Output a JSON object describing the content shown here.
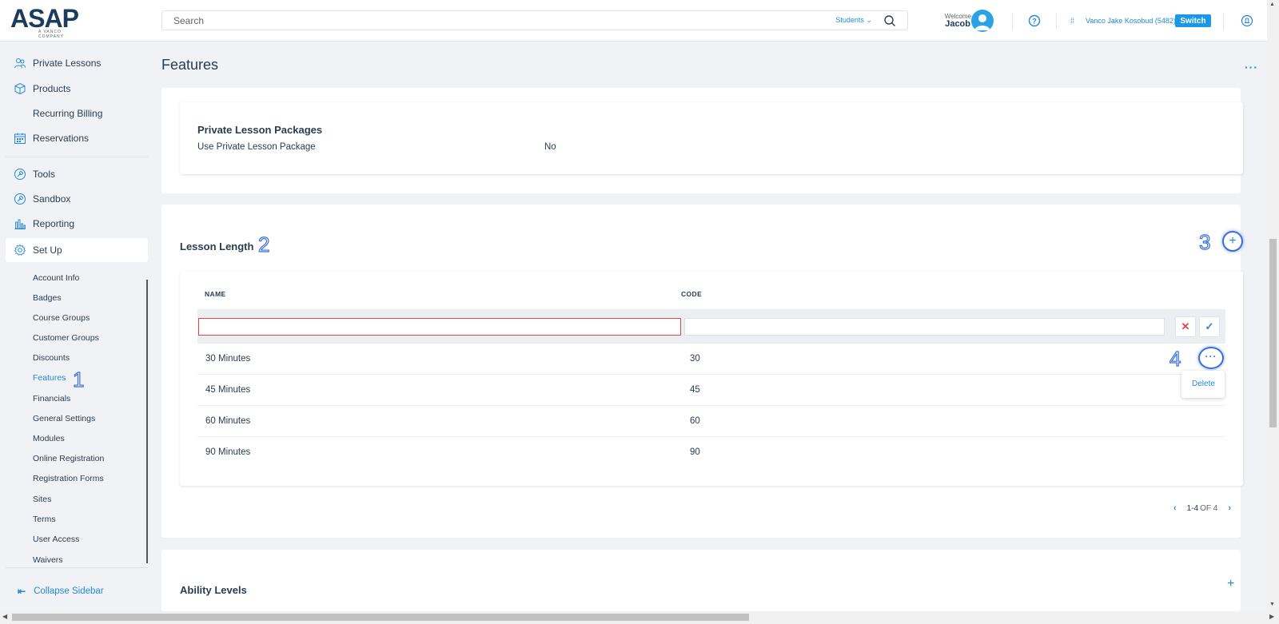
{
  "header": {
    "logo_text": "ASAP",
    "logo_subtext": "A VANCO COMPANY",
    "search_placeholder": "Search",
    "search_scope": "Students",
    "welcome_label": "Welcome",
    "user_name": "Jacob",
    "org_name": "Vanco Jake Kosobud (5482)",
    "switch_label": "Switch"
  },
  "sidebar": {
    "nav": [
      {
        "label": "Private Lessons",
        "icon": "people-icon"
      },
      {
        "label": "Products",
        "icon": "box-icon"
      },
      {
        "label": "Recurring Billing",
        "icon": ""
      },
      {
        "label": "Reservations",
        "icon": "calendar-icon"
      },
      {
        "label": "Tools",
        "icon": "tools-icon"
      },
      {
        "label": "Sandbox",
        "icon": "sandbox-icon"
      },
      {
        "label": "Reporting",
        "icon": "chart-icon"
      },
      {
        "label": "Set Up",
        "icon": "gear-icon"
      }
    ],
    "setup_items": [
      "Account Info",
      "Badges",
      "Course Groups",
      "Customer Groups",
      "Discounts",
      "Features",
      "Financials",
      "General Settings",
      "Modules",
      "Online Registration",
      "Registration Forms",
      "Sites",
      "Terms",
      "User Access",
      "Waivers"
    ],
    "active_setup_item": "Features",
    "collapse_label": "Collapse Sidebar"
  },
  "page": {
    "title": "Features",
    "more_label": "···"
  },
  "private_lesson_packages": {
    "title": "Private Lesson Packages",
    "field_label": "Use Private Lesson Package",
    "field_value": "No"
  },
  "lesson_length": {
    "title": "Lesson Length",
    "columns": [
      "NAME",
      "CODE"
    ],
    "new_row": {
      "name": "",
      "code": ""
    },
    "rows": [
      {
        "name": "30 Minutes",
        "code": "30"
      },
      {
        "name": "45 Minutes",
        "code": "45"
      },
      {
        "name": "60 Minutes",
        "code": "60"
      },
      {
        "name": "90 Minutes",
        "code": "90"
      }
    ],
    "row_menu": {
      "delete_label": "Delete"
    },
    "pager": {
      "range": "1-4",
      "of_label": "OF 4"
    }
  },
  "ability_levels": {
    "title": "Ability Levels"
  },
  "annotations": [
    "1",
    "2",
    "3",
    "4"
  ],
  "colors": {
    "accent": "#2489d6",
    "brand_dark": "#1c3c5e",
    "annotation": "#3a6fd8",
    "error": "#e04848"
  }
}
